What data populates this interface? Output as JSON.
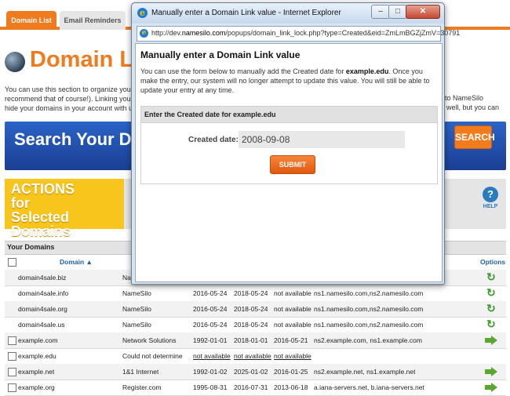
{
  "tabs": [
    {
      "label": "Domain List",
      "active": true
    },
    {
      "label": "Email Reminders",
      "active": false
    }
  ],
  "page": {
    "title": "Domain Link M",
    "intro_left": "You can use this section to organize your do",
    "intro_left_2": "recommend that of course!). Linking your ext",
    "intro_left_3": "hide your domains in your account with us by",
    "intro_right_1": "to NameSilo",
    "intro_right_2": "well, but you can",
    "search_banner": "Search Your Domain",
    "search_button": "SEARCH",
    "actions_text": "ACTIONS for Selected Domains",
    "help_label": "HELP",
    "your_domains": "Your Domains",
    "accent_color": "#f07a1e"
  },
  "table": {
    "headers": {
      "domain": "Domain",
      "options": "Options"
    },
    "rows": [
      {
        "domain": "domain4sale.biz",
        "registrar": "Nam",
        "created": "",
        "expires": "",
        "updated": "",
        "ns": "",
        "checkbox": false,
        "option": "renew-icon"
      },
      {
        "domain": "domain4sale.info",
        "registrar": "NameSilo",
        "created": "2016-05-24",
        "expires": "2018-05-24",
        "updated": "not available",
        "ns": "ns1.namesilo.com,ns2.namesilo.com",
        "checkbox": false,
        "option": "renew-icon"
      },
      {
        "domain": "domain4sale.org",
        "registrar": "NameSilo",
        "created": "2016-05-24",
        "expires": "2018-05-24",
        "updated": "not available",
        "ns": "ns1.namesilo.com,ns2.namesilo.com",
        "checkbox": false,
        "option": "renew-icon"
      },
      {
        "domain": "domain4sale.us",
        "registrar": "NameSilo",
        "created": "2016-05-24",
        "expires": "2018-05-24",
        "updated": "not available",
        "ns": "ns1.namesilo.com,ns2.namesilo.com",
        "checkbox": false,
        "option": "renew-icon"
      },
      {
        "domain": "example.com",
        "registrar": "Network Solutions",
        "created": "1992-01-01",
        "expires": "2018-01-01",
        "updated": "2016-05-21",
        "ns": "ns2.example.com, ns1.example.com",
        "checkbox": true,
        "option": "arrow-icon"
      },
      {
        "domain": "example.edu",
        "registrar": "Could not determine",
        "created": "not available",
        "expires": "not available",
        "updated": "not available",
        "ns": "",
        "checkbox": true,
        "option": ""
      },
      {
        "domain": "example.net",
        "registrar": "1&1 Internet",
        "created": "1992-01-02",
        "expires": "2025-01-02",
        "updated": "2016-01-25",
        "ns": "ns2.example.net, ns1.example.net",
        "checkbox": true,
        "option": "arrow-icon"
      },
      {
        "domain": "example.org",
        "registrar": "Register.com",
        "created": "1995-08-31",
        "expires": "2016-07-31",
        "updated": "2013-06-18",
        "ns": "a.iana-servers.net, b.iana-servers.net",
        "checkbox": true,
        "option": "arrow-icon"
      }
    ]
  },
  "dialog": {
    "window_title": "Manually enter a Domain Link value - Internet Explorer",
    "url_prefix": "http://dev.",
    "url_host": "namesilo.com",
    "url_rest": "/popups/domain_link_lock.php?type=Created&eid=ZmLmBGZjZmV=30791",
    "heading": "Manually enter a Domain Link value",
    "desc_before": "You can use the form below to manually add the Created date for ",
    "desc_domain": "example.edu",
    "desc_after": ". Once you make the entry, our system will no longer attempt to update this value. You will still be able to update your entry at any time.",
    "form_title": "Enter the Created date for example.edu",
    "field_label": "Created date:",
    "field_value": "2008-09-08",
    "submit_label": "SUBMIT",
    "close_glyph": "✕",
    "max_glyph": "□",
    "min_glyph": "–"
  }
}
